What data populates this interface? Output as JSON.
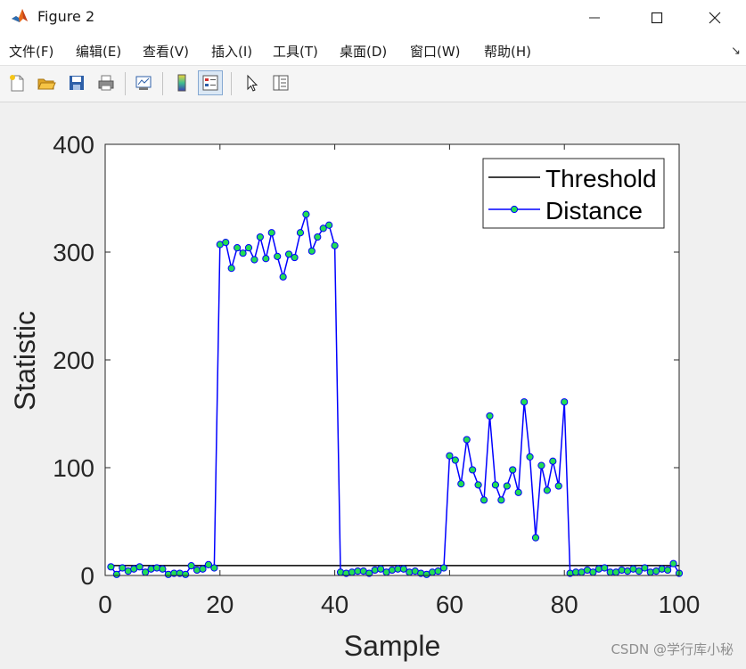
{
  "window": {
    "title": "Figure 2",
    "app_icon": "matlab-icon",
    "controls": [
      "minimize-icon",
      "maximize-icon",
      "close-icon"
    ]
  },
  "menu": {
    "items": [
      "文件(F)",
      "编辑(E)",
      "查看(V)",
      "插入(I)",
      "工具(T)",
      "桌面(D)",
      "窗口(W)",
      "帮助(H)"
    ],
    "dock_arrow": "↘"
  },
  "toolbar": {
    "buttons": [
      "new-figure-icon",
      "open-file-icon",
      "save-icon",
      "print-icon",
      "link-plot-icon",
      "colorbar-icon",
      "legend-icon",
      "select-pointer-icon",
      "property-inspector-icon"
    ],
    "active": "legend-icon"
  },
  "chart_data": {
    "type": "line",
    "title": "",
    "xlabel": "Sample",
    "ylabel": "Statistic",
    "xlim": [
      0,
      100
    ],
    "ylim": [
      0,
      400
    ],
    "xticks": [
      "0",
      "20",
      "40",
      "60",
      "80",
      "100"
    ],
    "yticks": [
      "0",
      "100",
      "200",
      "300",
      "400"
    ],
    "grid": false,
    "legend_position": "top-right",
    "series": [
      {
        "name": "Threshold",
        "color": "#000000",
        "marker": "none",
        "x": [
          1,
          100
        ],
        "values": [
          9.2,
          9.2
        ]
      },
      {
        "name": "Distance",
        "color": "#0000ff",
        "marker": "circle",
        "marker_face": "#22dd55",
        "x": [
          1,
          2,
          3,
          4,
          5,
          6,
          7,
          8,
          9,
          10,
          11,
          12,
          13,
          14,
          15,
          16,
          17,
          18,
          19,
          20,
          21,
          22,
          23,
          24,
          25,
          26,
          27,
          28,
          29,
          30,
          31,
          32,
          33,
          34,
          35,
          36,
          37,
          38,
          39,
          40,
          41,
          42,
          43,
          44,
          45,
          46,
          47,
          48,
          49,
          50,
          51,
          52,
          53,
          54,
          55,
          56,
          57,
          58,
          59,
          60,
          61,
          62,
          63,
          64,
          65,
          66,
          67,
          68,
          69,
          70,
          71,
          72,
          73,
          74,
          75,
          76,
          77,
          78,
          79,
          80,
          81,
          82,
          83,
          84,
          85,
          86,
          87,
          88,
          89,
          90,
          91,
          92,
          93,
          94,
          95,
          96,
          97,
          98,
          99,
          100
        ],
        "values": [
          8,
          1,
          7,
          4,
          6,
          8,
          3,
          6,
          7,
          6,
          1,
          2,
          2,
          1,
          9,
          5,
          6,
          10,
          7,
          307,
          309,
          285,
          304,
          299,
          304,
          293,
          314,
          294,
          318,
          296,
          277,
          298,
          295,
          318,
          335,
          301,
          314,
          322,
          325,
          306,
          3,
          2,
          3,
          4,
          4,
          2,
          5,
          6,
          3,
          5,
          6,
          6,
          3,
          4,
          2,
          1,
          3,
          4,
          7,
          111,
          107,
          85,
          126,
          98,
          84,
          70,
          148,
          84,
          70,
          83,
          98,
          77,
          161,
          110,
          35,
          102,
          79,
          106,
          83,
          161,
          2,
          3,
          3,
          5,
          3,
          6,
          7,
          3,
          3,
          5,
          4,
          6,
          4,
          7,
          3,
          4,
          6,
          5,
          11,
          2
        ]
      }
    ]
  },
  "watermark": "CSDN @学行库小秘"
}
